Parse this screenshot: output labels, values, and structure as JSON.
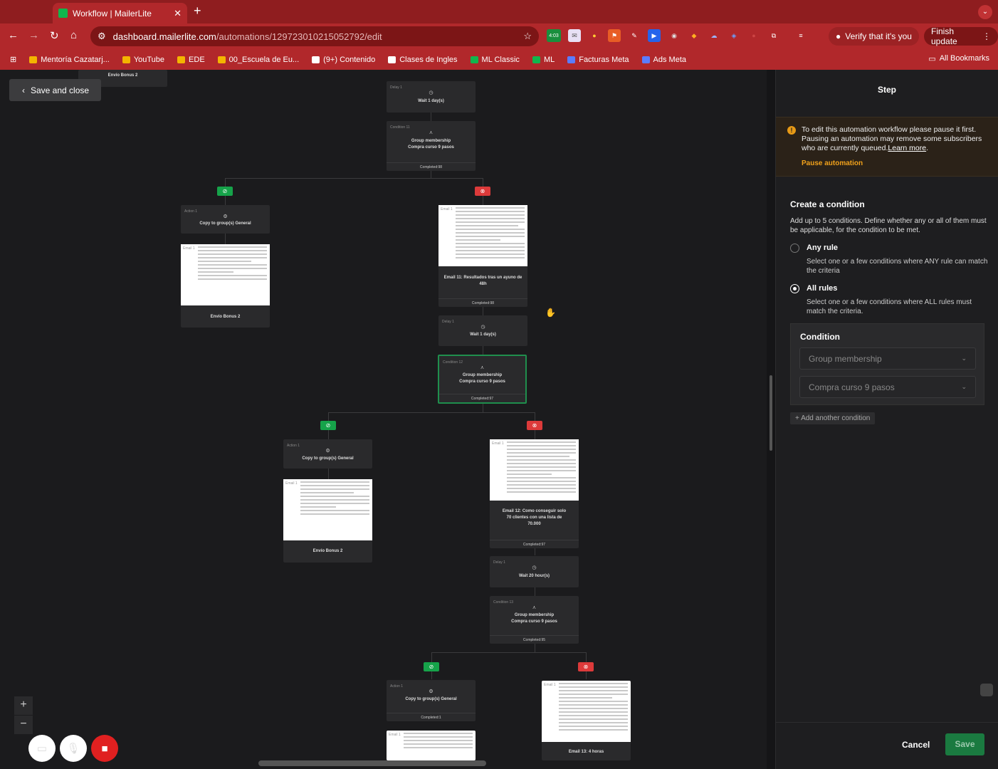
{
  "browser": {
    "tab_title": "Workflow | MailerLite",
    "url_host": "dashboard.mailerlite.com",
    "url_path": "/automations/129723010215052792/edit",
    "ext_badge": "4:03",
    "verify_label": "Verify that it's you",
    "finish_update_label": "Finish update",
    "bookmarks": [
      {
        "label": "Mentoría Cazatarj...",
        "color": "#f4b400"
      },
      {
        "label": "YouTube",
        "color": "#f4b400"
      },
      {
        "label": "EDE",
        "color": "#f4b400"
      },
      {
        "label": "00_Escuela de Eu...",
        "color": "#f4b400"
      },
      {
        "label": "(9+) Contenido",
        "color": "#ffffff"
      },
      {
        "label": "Clases de Ingles",
        "color": "#ffffff"
      },
      {
        "label": "ML Classic",
        "color": "#11b64d"
      },
      {
        "label": "ML",
        "color": "#11b64d"
      },
      {
        "label": "Facturas Meta",
        "color": "#5b7cff"
      },
      {
        "label": "Ads Meta",
        "color": "#5b7cff"
      }
    ],
    "all_bookmarks": "All Bookmarks"
  },
  "canvas": {
    "save_close": "Save and close",
    "top_stub": "Envío Bonus 2",
    "nodes": {
      "delay1_label": "Delay 1",
      "delay1_text": "Wait 1 day(s)",
      "cond11_label": "Condition 11",
      "cond11_l1": "Group membership",
      "cond11_l2": "Compra curso 9 pasos",
      "cond11_foot": "Completed:98",
      "act1a_label": "Action 1",
      "act1a_text": "Copy to group(s) General",
      "email_bonus_a": "Envío Bonus 2",
      "email11_text": "Email 11: Resultados tras un ayuno de 48h",
      "email11_foot": "Completed:98",
      "delay1b_label": "Delay 1",
      "delay1b_text": "Wait 1 day(s)",
      "cond12_label": "Condition 12",
      "cond12_l1": "Group membership",
      "cond12_l2": "Compra curso 9 pasos",
      "cond12_foot": "Completed:97",
      "act1b_label": "Action 1",
      "act1b_text": "Copy to group(s) General",
      "email_bonus_b": "Envío Bonus 2",
      "email12_text": "Email 12: Como conseguir solo 70 clientes con una lista de 70.000",
      "email12_foot": "Completed:97",
      "delay1c_label": "Delay 1",
      "delay1c_text": "Wait 20 hour(s)",
      "cond13_label": "Condition 13",
      "cond13_l1": "Group membership",
      "cond13_l2": "Compra curso 9 pasos",
      "cond13_foot": "Completed:95",
      "act1c_label": "Action 1",
      "act1c_text": "Copy to group(s) General",
      "act1c_foot": "Completed:1",
      "email13_text": "Email 13: 4 horas",
      "thumb_email": "Email 1"
    }
  },
  "panel": {
    "title": "Step",
    "warning": "To edit this automation workflow please pause it first. Pausing an automation may remove some subscribers who are currently queued.",
    "learn_more": "Learn more",
    "pause_label": "Pause automation",
    "section_title": "Create a condition",
    "section_desc": "Add up to 5 conditions. Define whether any or all of them must be applicable, for the condition to be met.",
    "any_rule": "Any rule",
    "any_rule_desc": "Select one or a few conditions where ANY rule can match the criteria",
    "all_rules": "All rules",
    "all_rules_desc": "Select one or a few conditions where ALL rules must match the criteria.",
    "selected_rule": "all",
    "condition_title": "Condition",
    "condition_type": "Group membership",
    "condition_group": "Compra curso 9 pasos",
    "add_condition": "+ Add another condition",
    "cancel": "Cancel",
    "save": "Save"
  },
  "colors": {
    "accent_green": "#16a34a",
    "warn_orange": "#f0a11b",
    "chrome_red": "#b1282b"
  }
}
